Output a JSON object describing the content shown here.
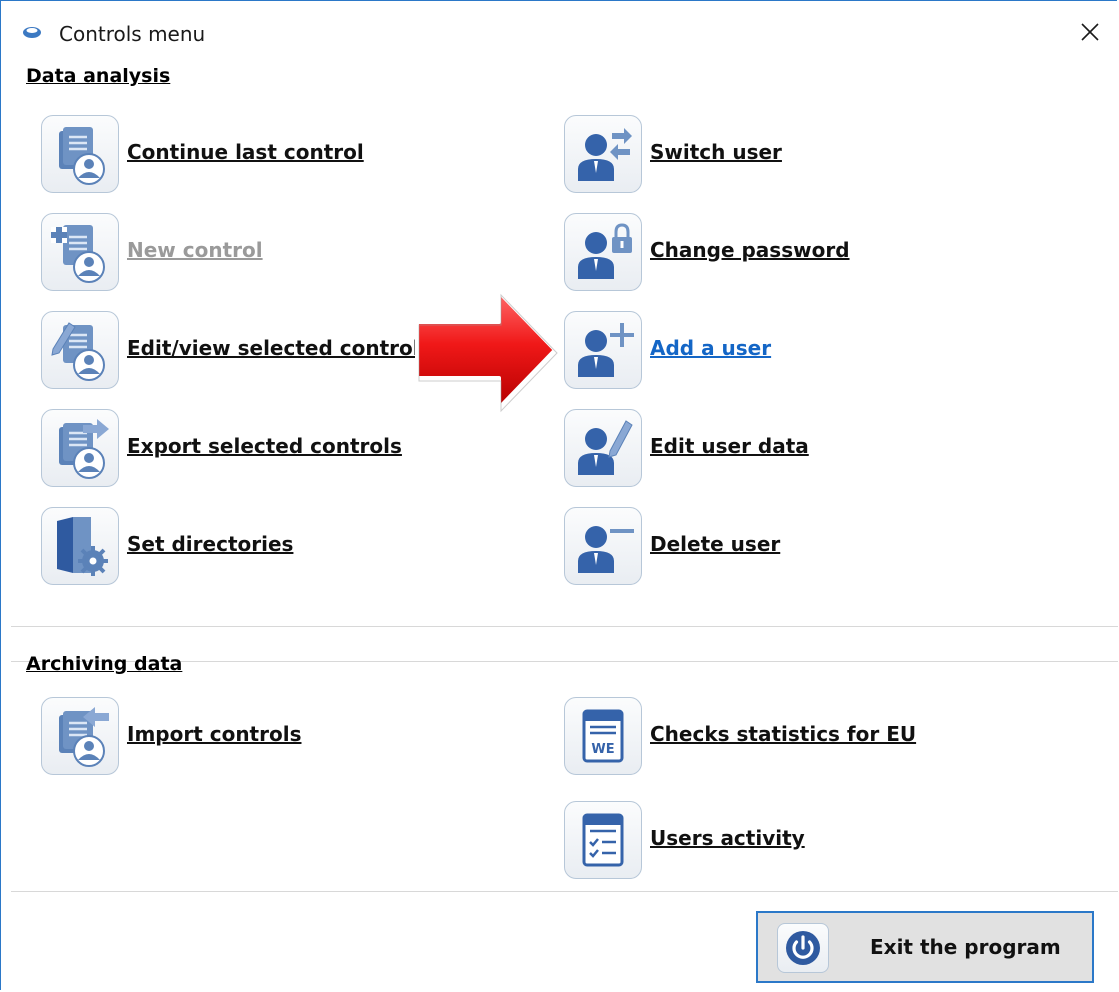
{
  "window": {
    "title": "Controls menu",
    "accent": "#2b78c8"
  },
  "sections": {
    "data_analysis": "Data analysis",
    "archiving_data": "Archiving data"
  },
  "items": {
    "continue_last_control": {
      "label": "Continue last control",
      "icon": "document-user-icon"
    },
    "new_control": {
      "label": "New control",
      "icon": "document-plus-icon",
      "disabled": true
    },
    "edit_view_selected_controls": {
      "label": "Edit/view selected controls",
      "icon": "document-pencil-icon"
    },
    "export_selected_controls": {
      "label": "Export selected controls",
      "icon": "document-export-icon"
    },
    "set_directories": {
      "label": "Set directories",
      "icon": "folder-gear-icon"
    },
    "switch_user": {
      "label": "Switch user",
      "icon": "user-switch-icon"
    },
    "change_password": {
      "label": "Change password",
      "icon": "user-lock-icon"
    },
    "add_user": {
      "label": "Add a user",
      "icon": "user-plus-icon",
      "highlighted": true
    },
    "edit_user_data": {
      "label": "Edit user data",
      "icon": "user-pencil-icon"
    },
    "delete_user": {
      "label": "Delete user",
      "icon": "user-minus-icon"
    },
    "import_controls": {
      "label": "Import controls",
      "icon": "document-import-icon"
    },
    "checks_statistics_eu": {
      "label": "Checks statistics for EU",
      "icon": "we-document-icon",
      "icon_text": "WE"
    },
    "users_activity": {
      "label": "Users activity",
      "icon": "checklist-icon"
    }
  },
  "exit": {
    "label": "Exit the program",
    "icon": "power-icon"
  },
  "colors": {
    "icon_blue": "#5b82b8",
    "icon_dark": "#2f5aa0",
    "icon_light": "#9ab6dc",
    "arrow_red": "#e01010",
    "link_blue": "#1466c6",
    "disabled_gray": "#9a9a9a"
  }
}
